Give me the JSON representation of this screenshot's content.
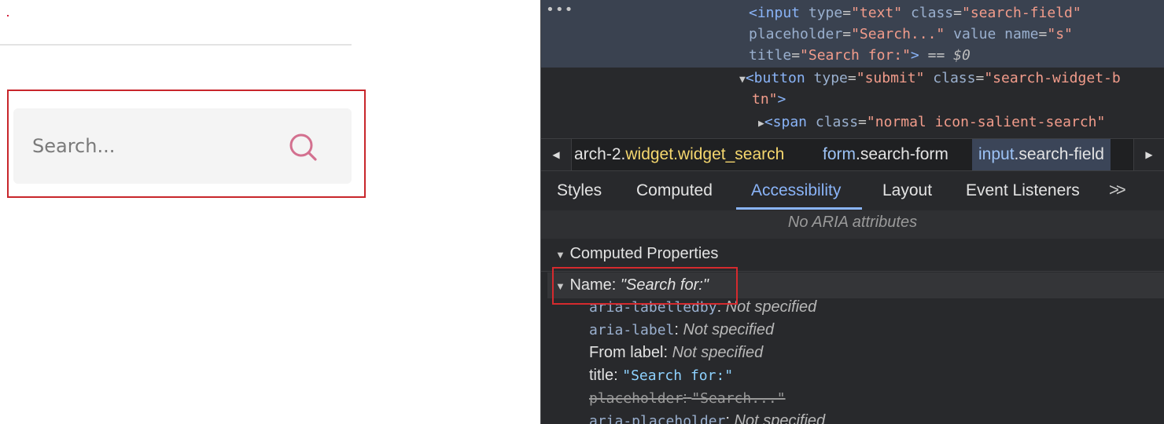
{
  "page": {
    "search_placeholder": "Search...",
    "search_value": ""
  },
  "devtools": {
    "ellipsis": "•••",
    "dom": {
      "line1": {
        "open": "<input",
        "a1": "type",
        "v1": "\"text\"",
        "a2": "class",
        "v2": "\"search-field\""
      },
      "line2": {
        "a1": "placeholder",
        "v1": "\"Search...\"",
        "a2": "value",
        "a3": "name",
        "v3": "\"s\""
      },
      "line3": {
        "a1": "title",
        "v1": "\"Search for:\"",
        "close": ">",
        "eq": "==",
        "ref": "$0"
      },
      "line4": {
        "open": "<button",
        "a1": "type",
        "v1": "\"submit\"",
        "a2": "class",
        "v2": "\"search-widget-b"
      },
      "line5": {
        "v": "tn\"",
        "close": ">"
      },
      "line6": {
        "open": "<span",
        "a1": "class",
        "v1": "\"normal icon-salient-search\""
      }
    },
    "breadcrumbs": [
      {
        "el": "arch-2.",
        "cls": "widget.widget_search"
      },
      {
        "el": "form",
        "cls": ".search-form"
      },
      {
        "el": "input",
        "cls": ".search-field"
      }
    ],
    "tabs": [
      "Styles",
      "Computed",
      "Accessibility",
      "Layout",
      "Event Listeners"
    ],
    "tabs_more": ">>",
    "active_tab": "Accessibility",
    "no_aria": "No ARIA attributes",
    "computed_properties": "Computed Properties",
    "name_label": "Name:",
    "name_value": "\"Search for:\"",
    "props": [
      {
        "key": "aria-labelledby",
        "sep": ":",
        "value": "Not specified"
      },
      {
        "key": "aria-label",
        "sep": ":",
        "value": "Not specified"
      },
      {
        "key": "From label",
        "sep": ":",
        "value": "Not specified"
      },
      {
        "key": "title",
        "sep": ":",
        "value": "\"Search for:\""
      },
      {
        "key": "placeholder",
        "sep": ":",
        "value": "\"Search...\""
      },
      {
        "key": "aria-placeholder",
        "sep": ":",
        "value": "Not specified"
      }
    ],
    "colors": {
      "tag": "#8ab4f8",
      "attr_value": "#f29c8b",
      "highlight_red": "#c8262b",
      "search_icon": "#d3708f"
    }
  }
}
